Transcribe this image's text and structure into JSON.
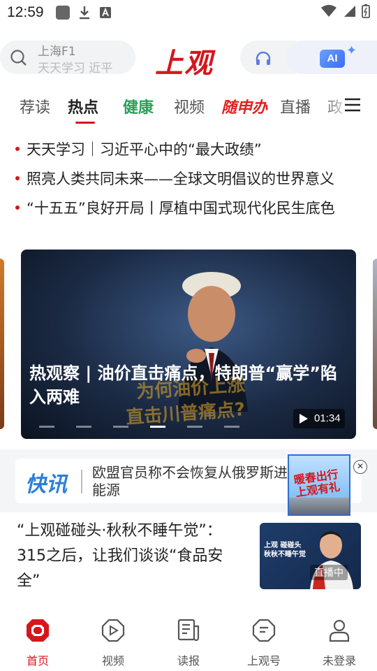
{
  "status_bar": {
    "time": "12:59"
  },
  "header": {
    "search_line1": "上海F1",
    "search_line2": "天天学习 近平",
    "brand": "上观",
    "ai_label": "AI"
  },
  "tabs": [
    {
      "label": "荐读"
    },
    {
      "label": "热点"
    },
    {
      "label": "健康"
    },
    {
      "label": "视频"
    },
    {
      "label": "随申办"
    },
    {
      "label": "直播"
    },
    {
      "label": "政"
    }
  ],
  "headlines": [
    "天天学习｜习近平心中的“最大政绩”",
    "照亮人类共同未来——全球文明倡议的世界意义",
    "“十五五”良好开局丨厚植中国式现代化民生底色"
  ],
  "carousel": {
    "title": "热观察 | 油价直击痛点，特朗普“赢学”陷入两难",
    "overlay_line1": "为何油价上涨",
    "overlay_line2": "直击川普痛点?",
    "duration": "01:34",
    "dot_count": 6,
    "active_dot": 3
  },
  "flash": {
    "logo": "快讯",
    "text": "欧盟官员称不会恢复从俄罗斯进口能源",
    "promo_text": "暖春出行\n上观有礼",
    "close": "✕"
  },
  "article": {
    "title": "“上观碰碰头·秋秋不睡午觉”：315之后，让我们谈谈“食品安全”",
    "thumb_text": "上观 碰碰头\n秋秋不睡午觉",
    "live_badge": "直播中"
  },
  "bottom_nav": [
    {
      "label": "首页",
      "icon": "home-icon"
    },
    {
      "label": "视频",
      "icon": "video-play-icon"
    },
    {
      "label": "读报",
      "icon": "newspaper-icon"
    },
    {
      "label": "上观号",
      "icon": "account-badge-icon"
    },
    {
      "label": "未登录",
      "icon": "user-icon"
    }
  ],
  "colors": {
    "brand_red": "#d4171e",
    "health_green": "#2aa15a",
    "flash_blue": "#2c7fd6"
  }
}
